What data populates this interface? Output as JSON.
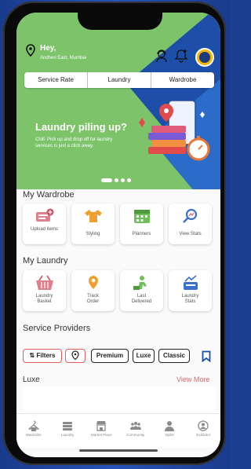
{
  "header": {
    "greeting": "Hey,",
    "location": "Andheri East, Mumbai"
  },
  "tabs": [
    "Service Rate",
    "Laundry",
    "Wardrobe"
  ],
  "banner": {
    "title": "Laundry piling up?",
    "subtitle": "Chill. Pick up and drop off for laundry services is just a click away.",
    "slide_count": 4,
    "active_slide": 0
  },
  "wardrobe": {
    "title": "My Wardrobe",
    "items": [
      {
        "label": "Upload items",
        "icon": "upload-clothes-icon"
      },
      {
        "label": "Styling",
        "icon": "shirt-icon"
      },
      {
        "label": "Planners",
        "icon": "calendar-icon"
      },
      {
        "label": "View Stats",
        "icon": "stats-search-icon"
      }
    ]
  },
  "laundry": {
    "title": "My Laundry",
    "items": [
      {
        "label": "Laundry Basket",
        "icon": "basket-icon"
      },
      {
        "label": "Track Order",
        "icon": "location-pin-icon"
      },
      {
        "label": "Last Delivered",
        "icon": "delivery-icon"
      },
      {
        "label": "Laundry Stats",
        "icon": "laundry-stats-icon"
      }
    ]
  },
  "providers": {
    "title": "Service Providers",
    "filters_label": "Filters",
    "chips": [
      "Premium",
      "Luxe",
      "Classic"
    ]
  },
  "luxe": {
    "title": "Luxe",
    "view_more": "View More"
  },
  "navbar": [
    "Wardrobe",
    "Laundry",
    "Market Place",
    "Community",
    "stylist",
    "Exhibitor"
  ],
  "colors": {
    "hero_green": "#7cc36a",
    "banner_blue": "#1d4fa8",
    "accent_red": "#e06060",
    "card_pink": "#e0808f",
    "card_orange": "#f0a030",
    "card_green": "#6fbf5a",
    "card_blue": "#3b6fd0"
  }
}
